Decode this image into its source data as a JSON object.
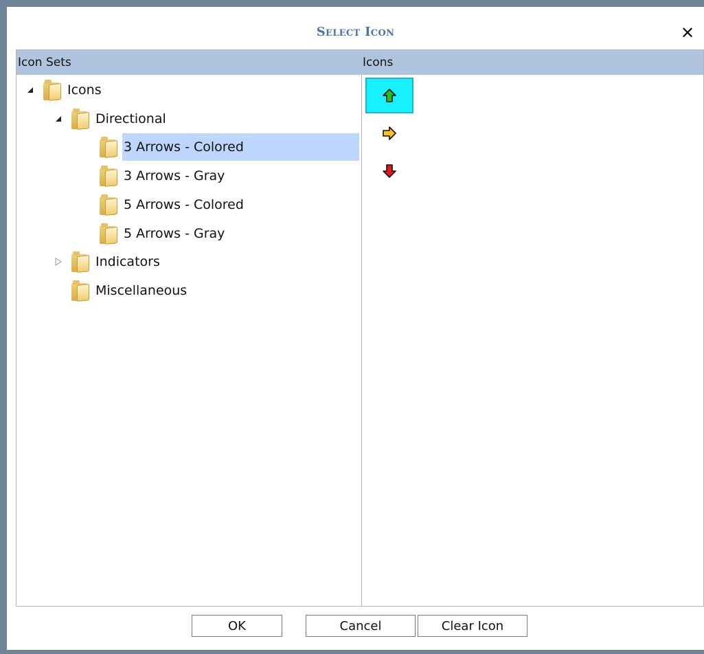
{
  "dialog": {
    "title": "Select Icon",
    "close_glyph": "✕"
  },
  "columns": {
    "left_header": "Icon Sets",
    "right_header": "Icons"
  },
  "tree": [
    {
      "label": "Icons",
      "level": 0,
      "expanded": true,
      "icon": "folder-icon"
    },
    {
      "label": "Directional",
      "level": 1,
      "expanded": true,
      "icon": "folder-icon"
    },
    {
      "label": "3 Arrows - Colored",
      "level": 2,
      "selected": true,
      "icon": "folder-icon"
    },
    {
      "label": "3 Arrows - Gray",
      "level": 2,
      "icon": "folder-icon"
    },
    {
      "label": "5 Arrows - Colored",
      "level": 2,
      "icon": "folder-icon"
    },
    {
      "label": "5 Arrows - Gray",
      "level": 2,
      "icon": "folder-icon"
    },
    {
      "label": "Indicators",
      "level": 1,
      "expanded": false,
      "icon": "folder-icon"
    },
    {
      "label": "Miscellaneous",
      "level": 1,
      "icon": "folder-icon"
    }
  ],
  "icons": [
    {
      "name": "arrow-up-green-icon",
      "color": "#22c022",
      "selected": true
    },
    {
      "name": "arrow-right-yellow-icon",
      "color": "#ffc21a",
      "selected": false
    },
    {
      "name": "arrow-down-red-icon",
      "color": "#e01818",
      "selected": false
    }
  ],
  "buttons": {
    "ok": "OK",
    "cancel": "Cancel",
    "clear_icon": "Clear Icon"
  },
  "colors": {
    "header_bg": "#b0c4de",
    "title_color": "#4a74aa",
    "selection_bg": "#bcd7fb",
    "icon_selected_bg": "#17f0ff"
  }
}
